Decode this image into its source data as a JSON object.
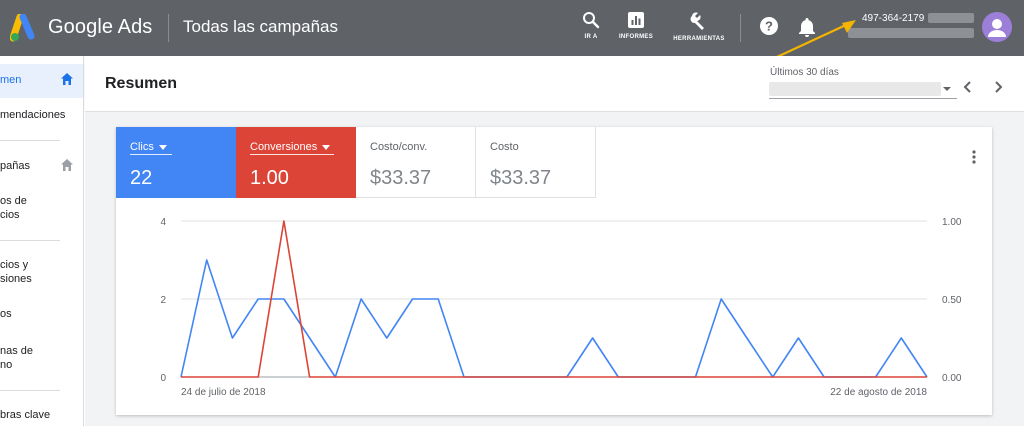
{
  "app": {
    "brand": "Google Ads",
    "page_heading": "Todas las campañas",
    "tools": [
      {
        "icon": "search-icon",
        "label": "IR A"
      },
      {
        "icon": "reports-icon",
        "label": "INFORMES"
      },
      {
        "icon": "wrench-icon",
        "label": "HERRAMIENTAS"
      }
    ],
    "account_id": "497-364-2179"
  },
  "sidebar": {
    "items": [
      {
        "label": "men",
        "active": true,
        "icon": "home-icon"
      },
      {
        "label": "mendaciones"
      },
      {
        "label": "pañas",
        "icon": "home-icon"
      },
      {
        "label": "os de"
      },
      {
        "label": "cios"
      },
      {
        "label": "cios y"
      },
      {
        "label": "siones"
      },
      {
        "label": "os"
      },
      {
        "label": "nas de"
      },
      {
        "label": "no"
      },
      {
        "label": "bras clave"
      }
    ]
  },
  "header": {
    "title": "Resumen",
    "date_range_label": "Últimos 30 días"
  },
  "metrics": [
    {
      "label": "Clics",
      "value": "22",
      "color": "#4285f4",
      "selected": true
    },
    {
      "label": "Conversiones",
      "value": "1.00",
      "color": "#db4437",
      "selected": true
    },
    {
      "label": "Costo/conv.",
      "value": "$33.37",
      "selected": false
    },
    {
      "label": "Costo",
      "value": "$33.37",
      "selected": false
    }
  ],
  "chart_data": {
    "type": "line",
    "x_start_label": "24 de julio de 2018",
    "x_end_label": "22 de agosto de 2018",
    "y_left_ticks": [
      "0",
      "2",
      "4"
    ],
    "y_right_ticks": [
      "0.00",
      "0.50",
      "1.00"
    ],
    "ylim_left": [
      0,
      4
    ],
    "ylim_right": [
      0,
      1
    ],
    "grid": true,
    "series": [
      {
        "name": "Clics",
        "axis": "left",
        "color": "#4285f4",
        "values": [
          0,
          3,
          1,
          2,
          2,
          1,
          0,
          2,
          1,
          2,
          2,
          0,
          0,
          0,
          0,
          0,
          1,
          0,
          0,
          0,
          0,
          2,
          1,
          0,
          1,
          0,
          0,
          0,
          1,
          0
        ]
      },
      {
        "name": "Conversiones",
        "axis": "right",
        "color": "#db4437",
        "values": [
          0,
          0,
          0,
          0,
          1,
          0,
          0,
          0,
          0,
          0,
          0,
          0,
          0,
          0,
          0,
          0,
          0,
          0,
          0,
          0,
          0,
          0,
          0,
          0,
          0,
          0,
          0,
          0,
          0,
          0
        ]
      }
    ]
  }
}
